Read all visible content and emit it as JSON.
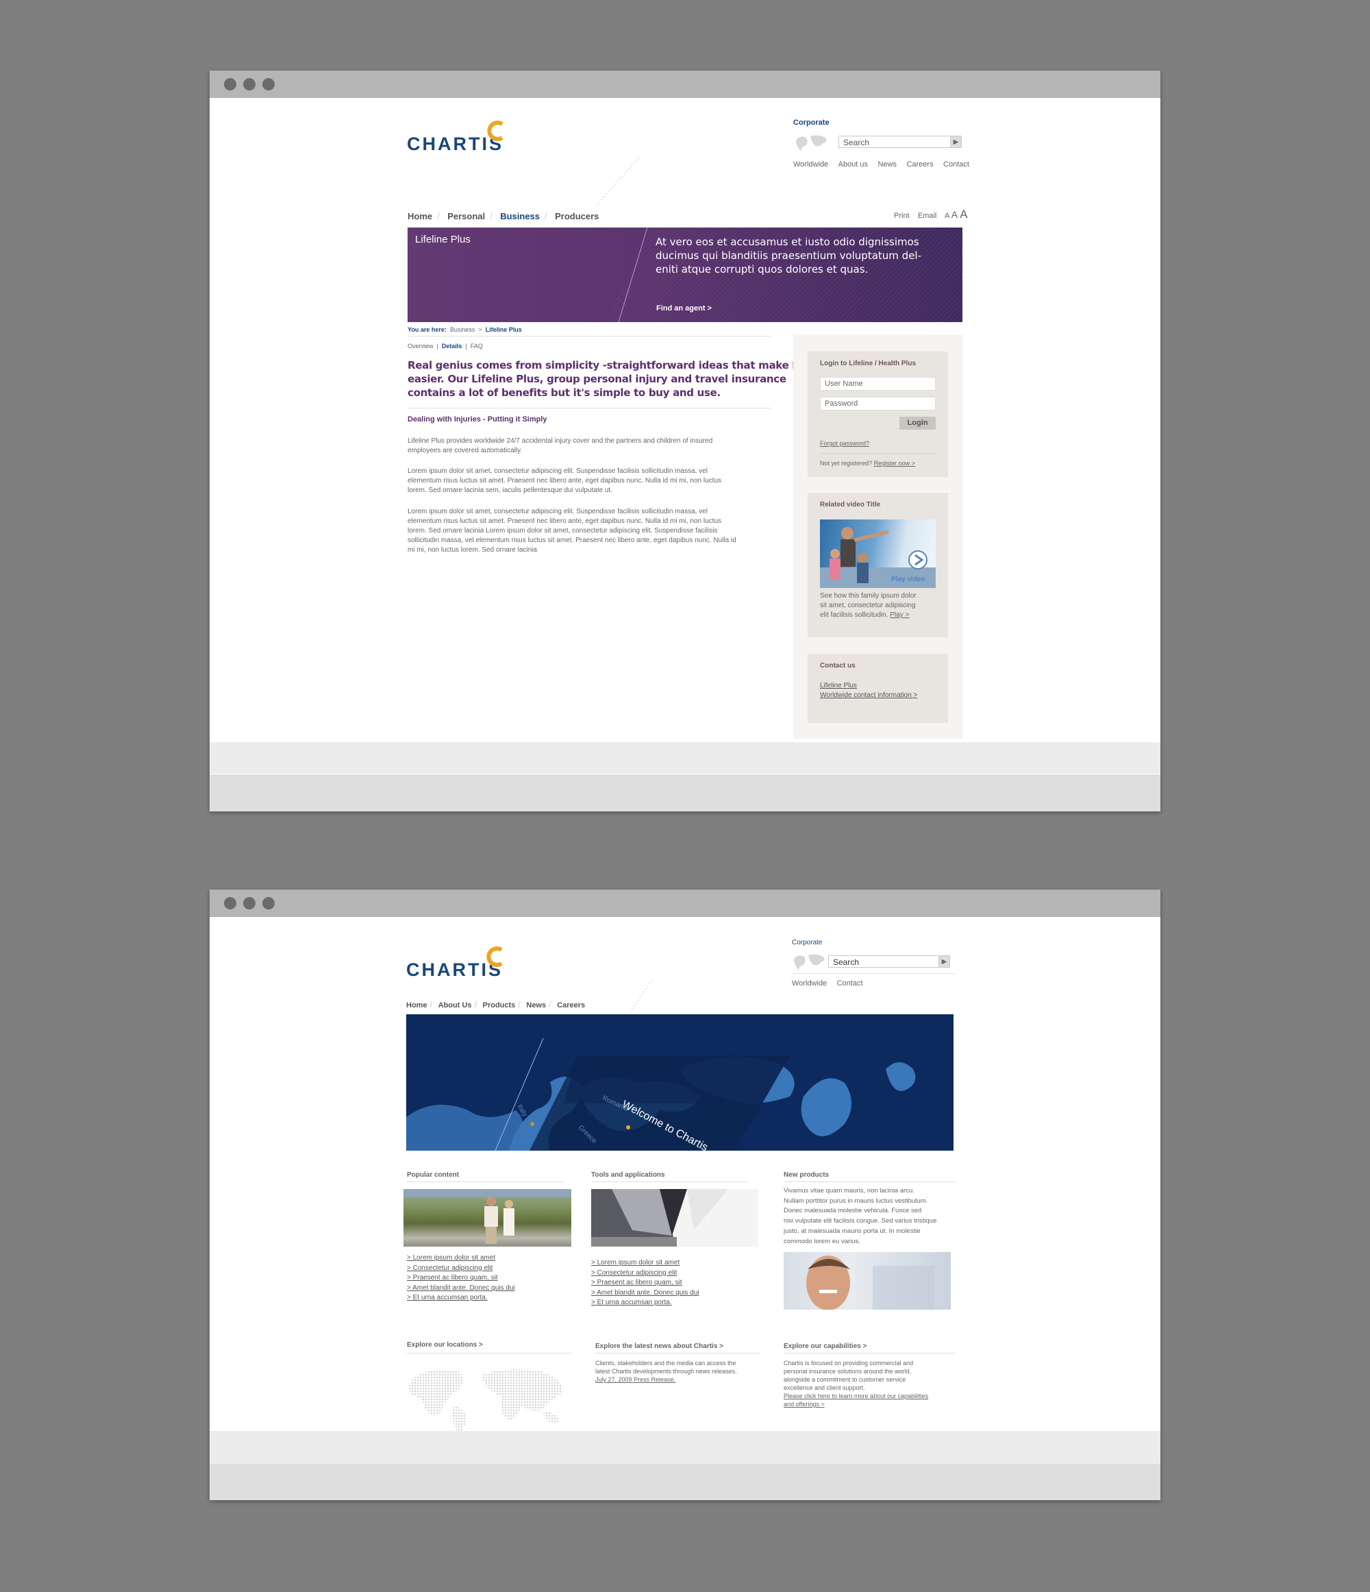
{
  "window1": {
    "logo_text": "CHARTIS",
    "corporate_label": "Corporate",
    "search_placeholder": "Search",
    "top_links": [
      "Worldwide",
      "About us",
      "News",
      "Careers",
      "Contact"
    ],
    "nav": [
      "Home",
      "Personal",
      "Business",
      "Producers"
    ],
    "nav_active": "Business",
    "tools": {
      "print": "Print",
      "email": "Email",
      "a_small": "A",
      "a_medium": "A",
      "a_large": "A"
    },
    "hero": {
      "title": "Lifeline Plus",
      "text_line1": "At vero eos et accusamus et iusto odio dignissimos",
      "text_line2": "ducimus qui blanditiis praesentium voluptatum del-",
      "text_line3": "eniti atque corrupti quos dolores et quas.",
      "cta": "Find an agent >",
      "color": "#5e3470"
    },
    "breadcrumb": {
      "label": "You are here:",
      "item1": "Business",
      "sep": ">",
      "item2": "Lifeline Plus"
    },
    "subtabs": [
      "Overview",
      "Details",
      "FAQ"
    ],
    "subtab_active": "Details",
    "intro_line1": "Real genius comes from simplicity -straightforward ideas that make life",
    "intro_line2": "easier. Our Lifeline Plus, group personal injury and travel insurance",
    "intro_line3": "contains a lot of benefits but it's simple to buy and use.",
    "section_heading": "Dealing with Injuries - Putting it Simply",
    "para1": [
      "Lifeline Plus provides worldwide 24/7 accidental injury cover and the partners and children of insured",
      "employees are covered automatically."
    ],
    "para2": [
      "Lorem ipsum dolor sit amet, consectetur adipiscing elit. Suspendisse facilisis sollicitudin massa, vel",
      "elementum risus luctus sit amet. Praesent nec libero ante, eget dapibus nunc. Nulla id mi mi, non luctus",
      "lorem. Sed ornare lacinia sem, iaculis pellentesque dui vulputate ut."
    ],
    "para3": [
      "Lorem ipsum dolor sit amet, consectetur adipiscing elit. Suspendisse facilisis sollicitudin massa, vel",
      "elementum risus luctus sit amet. Praesent nec libero ante, eget dapibus nunc. Nulla id mi mi, non luctus",
      "lorem. Sed ornare lacinia Lorem ipsum dolor sit amet, consectetur adipiscing elit. Suspendisse facilisis",
      "sollicitudin massa, vel elementum risus luctus sit amet. Praesent nec libero ante, eget dapibus nunc. Nulla id",
      "mi mi, non luctus lorem. Sed ornare lacinia"
    ],
    "login": {
      "title": "Login to Lifeline / Health Plus",
      "username_placeholder": "User Name",
      "password_placeholder": "Password",
      "button": "Login",
      "forgot": "Forgot password?",
      "not_registered": "Not yet registered?",
      "register": "Register now >"
    },
    "video": {
      "title": "Related video Title",
      "play": "Play video",
      "desc1": "See how this family ipsum dolor",
      "desc2": "sit amet, consectetur adipiscing",
      "desc3": "elit facilisis sollicitudin.",
      "play_link": "Play >"
    },
    "contact": {
      "title": "Contact us",
      "link1": "Lifeline Plus",
      "link2": "Worldwide contact information >"
    }
  },
  "window2": {
    "logo_text": "CHARTIS",
    "corporate_label": "Corporate",
    "search_value": "Search",
    "top_links": [
      "Worldwide",
      "Contact"
    ],
    "nav": [
      "Home",
      "About Us",
      "Products",
      "News",
      "Careers"
    ],
    "hero": {
      "welcome": "Welcome to Chartis",
      "map_labels": [
        "Italy",
        "Romania",
        "Greece"
      ],
      "color": "#0c2a5e"
    },
    "popular": {
      "title": "Popular content",
      "links": [
        "> Lorem ipsum dolor sit amet",
        "> Consectetur adipiscing elit",
        "> Praesent ac libero quam, sit",
        "> Amet blandit ante. Donec quis dui",
        "> Et urna accumsan porta."
      ]
    },
    "tools": {
      "title": "Tools and applications",
      "links": [
        "> Lorem ipsum dolor sit amet",
        "> Consectetur adipiscing elit",
        "> Praesent ac libero quam, sit",
        "> Amet blandit ante. Donec quis dui",
        "> Et urna accumsan porta."
      ]
    },
    "new_products": {
      "title": "New products",
      "lines": [
        "Vivamus vitae quam mauris, non lacinia arcu.",
        "Nullam porttitor purus in mauris luctus vestibulum.",
        "Donec malesuada molestie vehicula. Fusce sed",
        "nisi vulputate elit facilisis congue. Sed varius tristique",
        "justo, at malesuada mauris porta ut. In molestie",
        "commodo lorem eu varius."
      ]
    },
    "locations": {
      "title": "Explore our locations >"
    },
    "news": {
      "title": "Explore the latest news about Chartis >",
      "lines": [
        "Clients, stakeholders and the media can access the",
        "latest Chartis developments through news releases."
      ],
      "link": "July 27, 2009 Press Release."
    },
    "capabilities": {
      "title": "Explore our capabilities >",
      "lines": [
        "Chartis is focused on providing commercial and",
        "personal insurance solutions around the world,",
        "alongside a commitment to customer service",
        "excellence and client support."
      ],
      "link1": "Please click here to learn more about our capabilities",
      "link2": "and offerings >"
    }
  }
}
